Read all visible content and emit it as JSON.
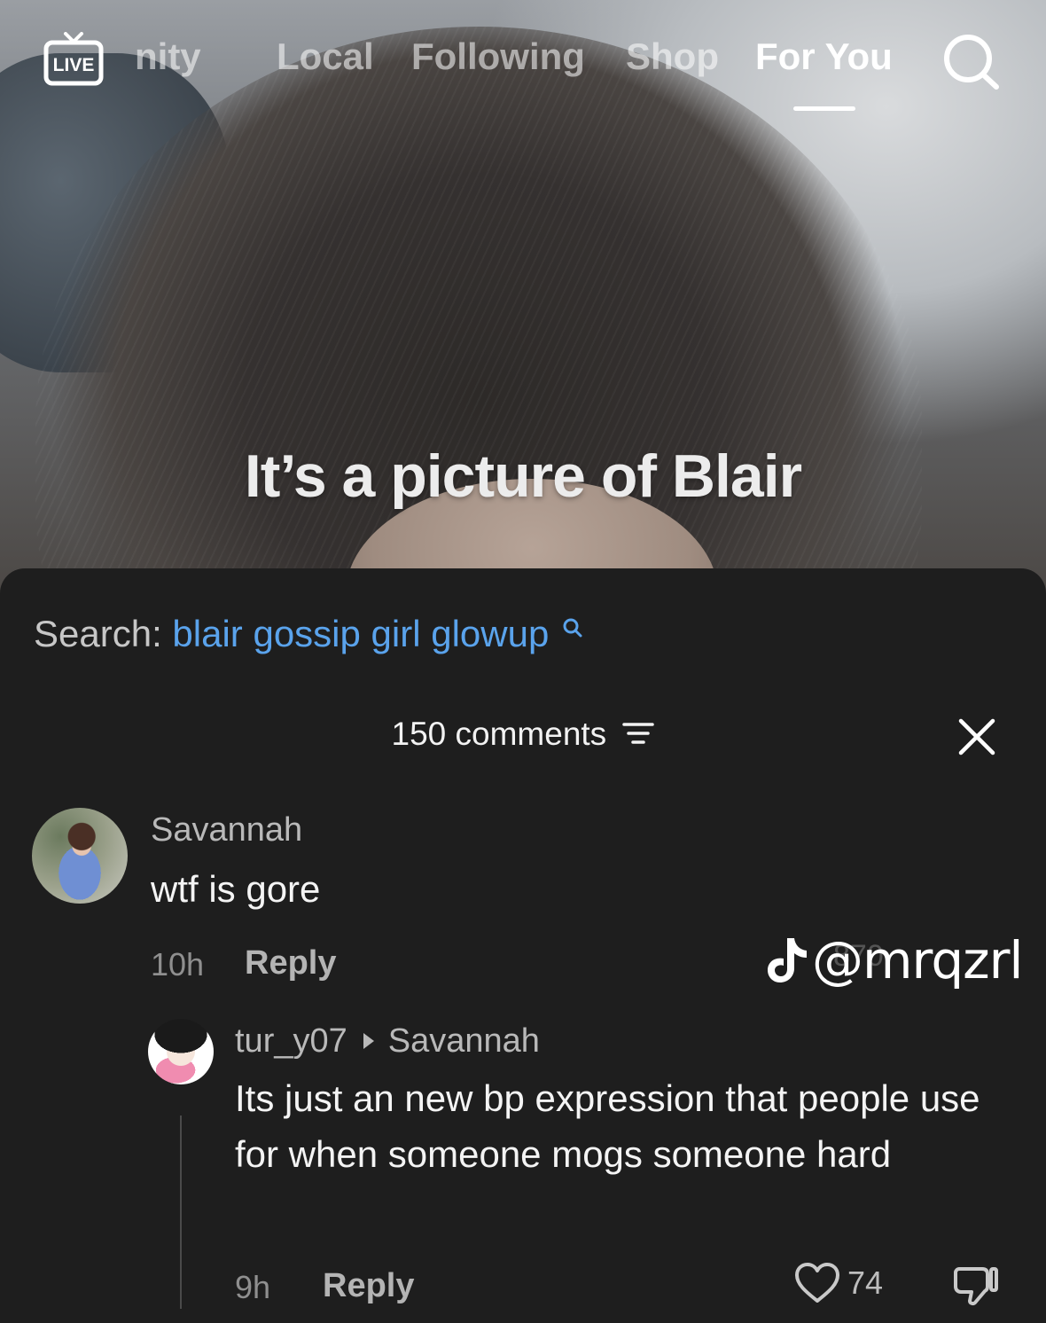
{
  "nav": {
    "tabs": [
      {
        "label": "nity",
        "active": false
      },
      {
        "label": "Local",
        "active": false
      },
      {
        "label": "Following",
        "active": false
      },
      {
        "label": "Shop",
        "active": false
      },
      {
        "label": "For You",
        "active": true
      }
    ],
    "live_label": "LIVE",
    "search_icon": "search-icon"
  },
  "video": {
    "caption": "It’s a picture of Blair"
  },
  "sheet": {
    "search_label": "Search:",
    "search_query": "blair gossip girl glowup",
    "comments_count": "150 comments",
    "close_icon": "close-icon"
  },
  "comments": [
    {
      "username": "Savannah",
      "text": "wtf is gore",
      "time": "10h",
      "reply_label": "Reply",
      "likes": "870"
    },
    {
      "username": "tur_y07",
      "reply_to": "Savannah",
      "text": "Its just an new bp expression that people use for when someone mogs someone hard",
      "time": "9h",
      "reply_label": "Reply",
      "likes": "74"
    }
  ],
  "watermark": {
    "handle": "@mrqzrl",
    "icon": "tiktok-logo-icon"
  },
  "colors": {
    "sheet_bg": "#1e1e1e",
    "link_blue": "#5aa3ec",
    "muted_text": "#8f8f8f"
  }
}
